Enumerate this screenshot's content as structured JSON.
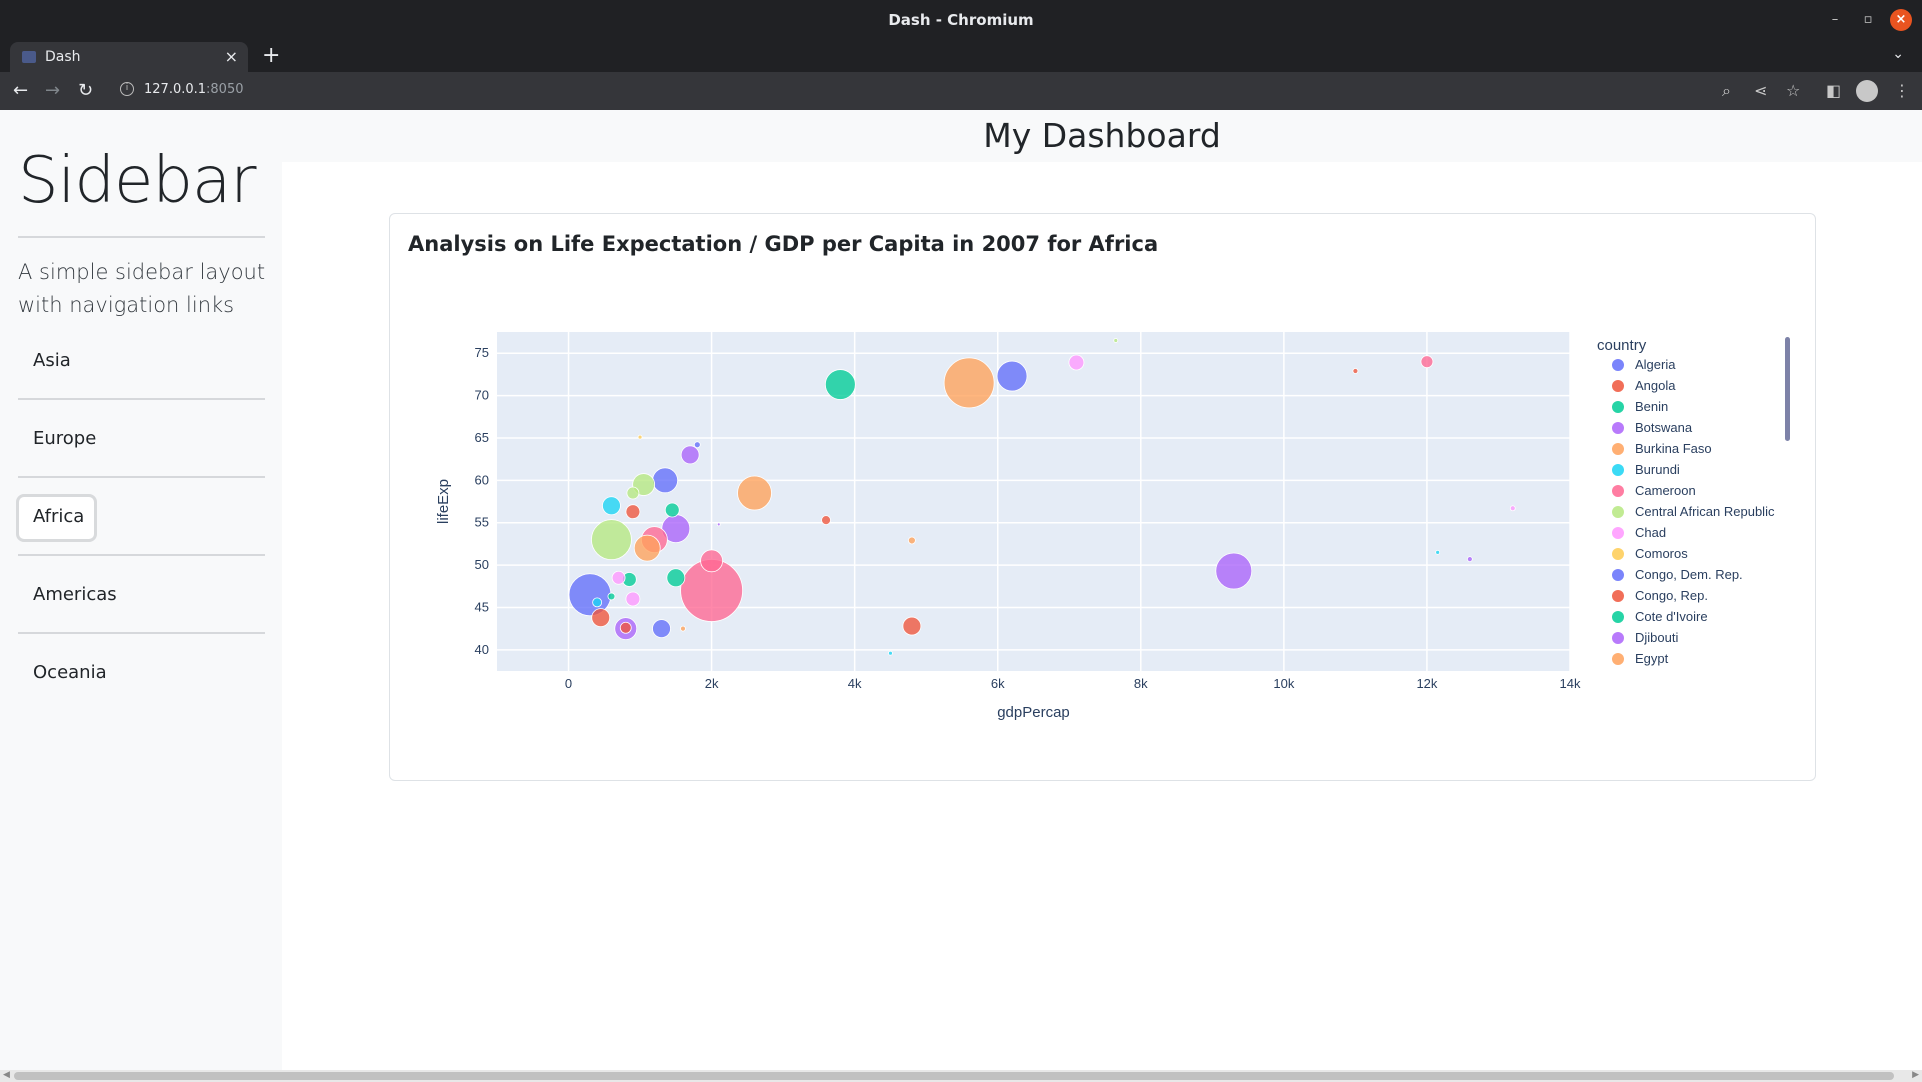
{
  "window": {
    "title": "Dash - Chromium"
  },
  "tab": {
    "label": "Dash"
  },
  "address": {
    "host": "127.0.0.1",
    "port": ":8050"
  },
  "sidebar": {
    "title": "Sidebar",
    "lead": "A simple sidebar layout with navigation links",
    "links": [
      "Asia",
      "Europe",
      "Africa",
      "Americas",
      "Oceania"
    ],
    "active": "Africa"
  },
  "header": {
    "title": "My Dashboard"
  },
  "card": {
    "title": "Analysis on Life Expectation / GDP per Capita in 2007 for Africa"
  },
  "chart_data": {
    "type": "scatter",
    "xlabel": "gdpPercap",
    "ylabel": "lifeExp",
    "xlim": [
      -1000,
      14000
    ],
    "ylim": [
      37.5,
      77.5
    ],
    "xticks": [
      "0",
      "2k",
      "4k",
      "6k",
      "8k",
      "10k",
      "12k",
      "14k"
    ],
    "xtick_values": [
      0,
      2000,
      4000,
      6000,
      8000,
      10000,
      12000,
      14000
    ],
    "yticks": [
      "40",
      "45",
      "50",
      "55",
      "60",
      "65",
      "70",
      "75"
    ],
    "ytick_values": [
      40,
      45,
      50,
      55,
      60,
      65,
      70,
      75
    ],
    "legend_title": "country",
    "legend_placement": "right",
    "grid": true,
    "plot_bg": "#e5ecf6",
    "series": [
      {
        "name": "Algeria",
        "color": "#636efa"
      },
      {
        "name": "Angola",
        "color": "#ef553b"
      },
      {
        "name": "Benin",
        "color": "#00cc96"
      },
      {
        "name": "Botswana",
        "color": "#ab63fa"
      },
      {
        "name": "Burkina Faso",
        "color": "#ffa15a"
      },
      {
        "name": "Burundi",
        "color": "#19d3f3"
      },
      {
        "name": "Cameroon",
        "color": "#ff6692"
      },
      {
        "name": "Central African Republic",
        "color": "#b6e880"
      },
      {
        "name": "Chad",
        "color": "#ff97ff"
      },
      {
        "name": "Comoros",
        "color": "#fecb52"
      },
      {
        "name": "Congo, Dem. Rep.",
        "color": "#636efa"
      },
      {
        "name": "Congo, Rep.",
        "color": "#ef553b"
      },
      {
        "name": "Cote d'Ivoire",
        "color": "#00cc96"
      },
      {
        "name": "Djibouti",
        "color": "#ab63fa"
      },
      {
        "name": "Egypt",
        "color": "#ffa15a"
      }
    ],
    "points": [
      {
        "x": 2000,
        "y": 47,
        "s": 62,
        "c": "#ff6692"
      },
      {
        "x": 5600,
        "y": 71.5,
        "s": 50,
        "c": "#ffa15a"
      },
      {
        "x": 300,
        "y": 46.5,
        "s": 42,
        "c": "#636efa"
      },
      {
        "x": 600,
        "y": 53,
        "s": 40,
        "c": "#b6e880"
      },
      {
        "x": 3800,
        "y": 71.3,
        "s": 30,
        "c": "#00cc96"
      },
      {
        "x": 6200,
        "y": 72.3,
        "s": 30,
        "c": "#636efa"
      },
      {
        "x": 9300,
        "y": 49.3,
        "s": 36,
        "c": "#ab63fa"
      },
      {
        "x": 2600,
        "y": 58.5,
        "s": 34,
        "c": "#ffa15a"
      },
      {
        "x": 1200,
        "y": 53,
        "s": 26,
        "c": "#ff6692"
      },
      {
        "x": 1500,
        "y": 54.3,
        "s": 28,
        "c": "#ab63fa"
      },
      {
        "x": 1350,
        "y": 60,
        "s": 25,
        "c": "#636efa"
      },
      {
        "x": 1050,
        "y": 59.5,
        "s": 22,
        "c": "#b6e880"
      },
      {
        "x": 1100,
        "y": 52,
        "s": 26,
        "c": "#ffa15a"
      },
      {
        "x": 2000,
        "y": 50.5,
        "s": 22,
        "c": "#ff6692"
      },
      {
        "x": 1700,
        "y": 63,
        "s": 18,
        "c": "#ab63fa"
      },
      {
        "x": 4800,
        "y": 42.8,
        "s": 18,
        "c": "#ef553b"
      },
      {
        "x": 800,
        "y": 42.5,
        "s": 22,
        "c": "#ab63fa"
      },
      {
        "x": 1300,
        "y": 42.5,
        "s": 18,
        "c": "#636efa"
      },
      {
        "x": 450,
        "y": 43.8,
        "s": 18,
        "c": "#ef553b"
      },
      {
        "x": 600,
        "y": 57,
        "s": 18,
        "c": "#19d3f3"
      },
      {
        "x": 1500,
        "y": 48.5,
        "s": 18,
        "c": "#00cc96"
      },
      {
        "x": 850,
        "y": 48.3,
        "s": 14,
        "c": "#00cc96"
      },
      {
        "x": 900,
        "y": 46,
        "s": 14,
        "c": "#ff97ff"
      },
      {
        "x": 700,
        "y": 48.5,
        "s": 13,
        "c": "#ff97ff"
      },
      {
        "x": 900,
        "y": 56.3,
        "s": 14,
        "c": "#ef553b"
      },
      {
        "x": 1450,
        "y": 56.5,
        "s": 14,
        "c": "#00cc96"
      },
      {
        "x": 900,
        "y": 58.5,
        "s": 12,
        "c": "#b6e880"
      },
      {
        "x": 7100,
        "y": 73.9,
        "s": 15,
        "c": "#ff97ff"
      },
      {
        "x": 12000,
        "y": 74,
        "s": 12,
        "c": "#ff6692"
      },
      {
        "x": 3600,
        "y": 55.3,
        "s": 9,
        "c": "#ef553b"
      },
      {
        "x": 800,
        "y": 42.6,
        "s": 11,
        "c": "#ef553b"
      },
      {
        "x": 400,
        "y": 45.6,
        "s": 9,
        "c": "#19d3f3"
      },
      {
        "x": 600,
        "y": 46.3,
        "s": 7,
        "c": "#00cc96"
      },
      {
        "x": 4800,
        "y": 52.9,
        "s": 7,
        "c": "#ffa15a"
      },
      {
        "x": 1800,
        "y": 64.2,
        "s": 6,
        "c": "#636efa"
      },
      {
        "x": 11000,
        "y": 72.9,
        "s": 5,
        "c": "#ef553b"
      },
      {
        "x": 13200,
        "y": 56.7,
        "s": 5,
        "c": "#ff97ff"
      },
      {
        "x": 12600,
        "y": 50.7,
        "s": 5,
        "c": "#ab63fa"
      },
      {
        "x": 12150,
        "y": 51.5,
        "s": 4,
        "c": "#19d3f3"
      },
      {
        "x": 7650,
        "y": 76.5,
        "s": 4,
        "c": "#b6e880"
      },
      {
        "x": 4500,
        "y": 39.6,
        "s": 4,
        "c": "#19d3f3"
      },
      {
        "x": 2100,
        "y": 54.8,
        "s": 3,
        "c": "#ab63fa"
      },
      {
        "x": 1000,
        "y": 65.1,
        "s": 4,
        "c": "#fecb52"
      },
      {
        "x": 1600,
        "y": 42.5,
        "s": 5,
        "c": "#ffa15a"
      }
    ]
  }
}
